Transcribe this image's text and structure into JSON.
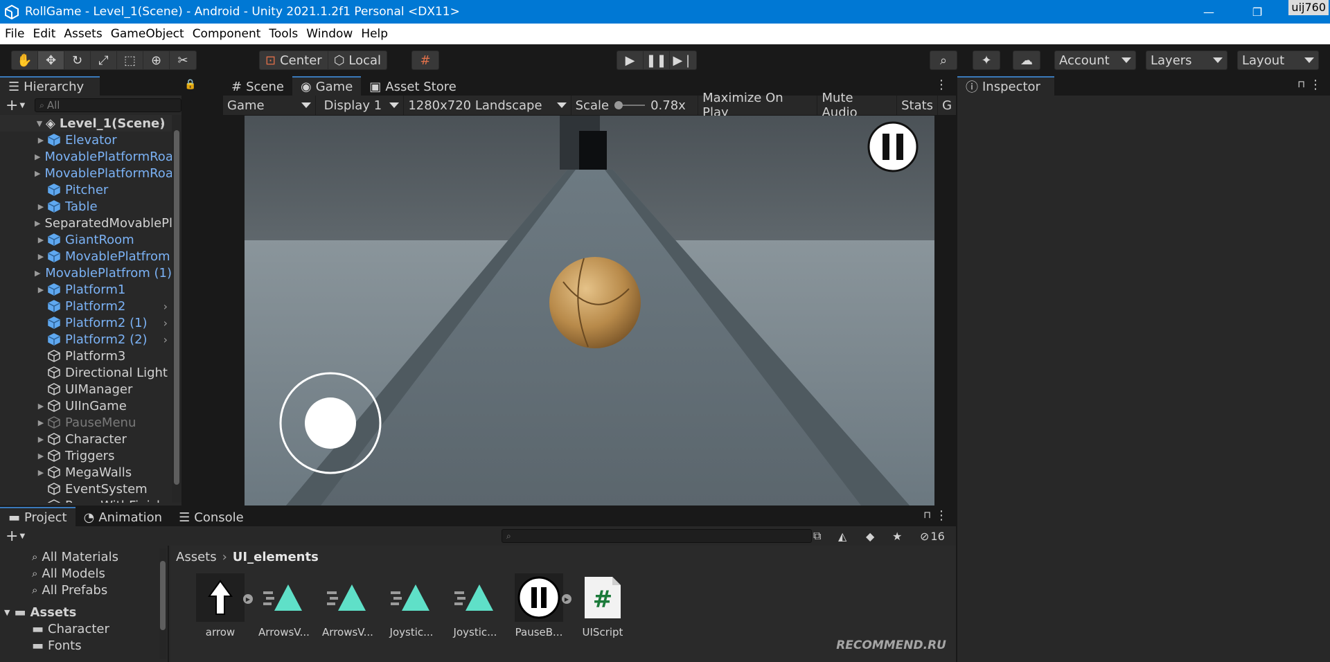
{
  "window": {
    "title": "RollGame - Level_1(Scene) - Android - Unity 2021.1.2f1 Personal <DX11>",
    "user_badge": "uij760"
  },
  "menu": [
    "File",
    "Edit",
    "Assets",
    "GameObject",
    "Component",
    "Tools",
    "Window",
    "Help"
  ],
  "toolbar": {
    "pivot_label": "Center",
    "space_label": "Local",
    "account_label": "Account",
    "layers_label": "Layers",
    "layout_label": "Layout"
  },
  "hierarchy": {
    "tab_label": "Hierarchy",
    "search_placeholder": "All",
    "scene_name": "Level_1(Scene)",
    "items": [
      {
        "label": "Elevator",
        "prefab": true,
        "expandable": true
      },
      {
        "label": "MovablePlatformRoa",
        "prefab": true,
        "expandable": true
      },
      {
        "label": "MovablePlatformRoa",
        "prefab": true,
        "expandable": true
      },
      {
        "label": "Pitcher",
        "prefab": true,
        "expandable": false
      },
      {
        "label": "Table",
        "prefab": true,
        "expandable": true
      },
      {
        "label": "SeparatedMovablePl",
        "prefab": false,
        "expandable": true
      },
      {
        "label": "GiantRoom",
        "prefab": true,
        "expandable": true
      },
      {
        "label": "MovablePlatfrom",
        "prefab": true,
        "expandable": true
      },
      {
        "label": "MovablePlatfrom (1)",
        "prefab": true,
        "expandable": true
      },
      {
        "label": "Platform1",
        "prefab": true,
        "expandable": true
      },
      {
        "label": "Platform2",
        "prefab": true,
        "expandable": false,
        "chevron": true
      },
      {
        "label": "Platform2 (1)",
        "prefab": true,
        "expandable": false,
        "chevron": true
      },
      {
        "label": "Platform2 (2)",
        "prefab": true,
        "expandable": false,
        "chevron": true
      },
      {
        "label": "Platform3",
        "prefab": false,
        "expandable": false
      },
      {
        "label": "Directional Light",
        "prefab": false,
        "expandable": false
      },
      {
        "label": "UIManager",
        "prefab": false,
        "expandable": false
      },
      {
        "label": "UIInGame",
        "prefab": false,
        "expandable": true
      },
      {
        "label": "PauseMenu",
        "prefab": false,
        "expandable": true,
        "disabled": true
      },
      {
        "label": "Character",
        "prefab": false,
        "expandable": true
      },
      {
        "label": "Triggers",
        "prefab": false,
        "expandable": true
      },
      {
        "label": "MegaWalls",
        "prefab": false,
        "expandable": true
      },
      {
        "label": "EventSystem",
        "prefab": false,
        "expandable": false
      },
      {
        "label": "RoomWithFinish",
        "prefab": false,
        "expandable": true
      }
    ]
  },
  "center": {
    "tabs": [
      {
        "label": "Scene",
        "active": false
      },
      {
        "label": "Game",
        "active": true
      },
      {
        "label": "Asset Store",
        "active": false
      }
    ],
    "game_toolbar": {
      "mode": "Game",
      "display": "Display 1",
      "resolution": "1280x720 Landscape",
      "scale_label": "Scale",
      "scale_value": "0.78x",
      "maximize": "Maximize On Play",
      "mute": "Mute Audio",
      "stats": "Stats",
      "gizmos": "G"
    }
  },
  "inspector": {
    "tab_label": "Inspector"
  },
  "project": {
    "tabs": [
      {
        "label": "Project",
        "active": true
      },
      {
        "label": "Animation",
        "active": false
      },
      {
        "label": "Console",
        "active": false
      }
    ],
    "hidden_count": "16",
    "favorites": [
      "All Materials",
      "All Models",
      "All Prefabs"
    ],
    "tree": [
      {
        "label": "Assets",
        "bold": true,
        "level": 0
      },
      {
        "label": "Character",
        "bold": false,
        "level": 1
      },
      {
        "label": "Fonts",
        "bold": false,
        "level": 1
      }
    ],
    "breadcrumb": [
      "Assets",
      "UI_elements"
    ],
    "assets": [
      {
        "name": "arrow",
        "kind": "arrow",
        "expandable": true
      },
      {
        "name": "ArrowsV...",
        "kind": "anim",
        "expandable": false
      },
      {
        "name": "ArrowsV...",
        "kind": "anim",
        "expandable": false
      },
      {
        "name": "Joystic...",
        "kind": "anim",
        "expandable": false
      },
      {
        "name": "Joystic...",
        "kind": "anim",
        "expandable": false
      },
      {
        "name": "PauseB...",
        "kind": "pause",
        "expandable": true
      },
      {
        "name": "UIScript",
        "kind": "script",
        "expandable": false
      }
    ]
  },
  "watermark": "RECOMMEND.RU",
  "colors": {
    "titlebar": "#0078d4",
    "prefab_text": "#7bb2f5",
    "active_tab_accent": "#3a79bb",
    "editor_bg": "#282828"
  }
}
